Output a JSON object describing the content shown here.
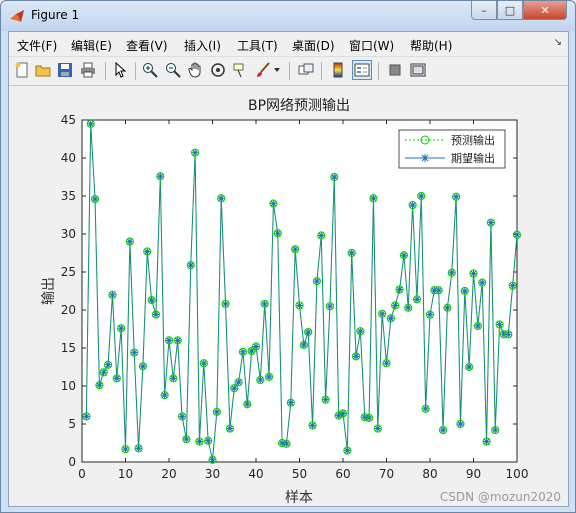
{
  "window": {
    "title": "Figure 1",
    "minimize": "–",
    "maximize": "□",
    "close": "✕"
  },
  "menu": {
    "items": [
      "文件(F)",
      "编辑(E)",
      "查看(V)",
      "插入(I)",
      "工具(T)",
      "桌面(D)",
      "窗口(W)",
      "帮助(H)"
    ],
    "overflow": "↘"
  },
  "toolbar": {
    "icons": [
      "new-figure-icon",
      "open-file-icon",
      "save-icon",
      "print-icon",
      "pointer-icon",
      "zoom-in-icon",
      "zoom-out-icon",
      "pan-hand-icon",
      "rotate-3d-icon",
      "data-cursor-icon",
      "brush-icon",
      "link-plot-icon",
      "colorbar-icon",
      "legend-icon",
      "hide-plot-tools-icon",
      "show-plot-tools-icon"
    ]
  },
  "watermark": "CSDN @mozun2020",
  "chart_data": {
    "type": "line",
    "title": "BP网络预测输出",
    "xlabel": "样本",
    "ylabel": "输出",
    "xlim": [
      0,
      100
    ],
    "ylim": [
      0,
      45
    ],
    "xticks": [
      0,
      10,
      20,
      30,
      40,
      50,
      60,
      70,
      80,
      90,
      100
    ],
    "yticks": [
      0,
      5,
      10,
      15,
      20,
      25,
      30,
      35,
      40,
      45
    ],
    "grid": false,
    "legend_position": "top-right",
    "x": [
      1,
      2,
      3,
      4,
      5,
      6,
      7,
      8,
      9,
      10,
      11,
      12,
      13,
      14,
      15,
      16,
      17,
      18,
      19,
      20,
      21,
      22,
      23,
      24,
      25,
      26,
      27,
      28,
      29,
      30,
      31,
      32,
      33,
      34,
      35,
      36,
      37,
      38,
      39,
      40,
      41,
      42,
      43,
      44,
      45,
      46,
      47,
      48,
      49,
      50,
      51,
      52,
      53,
      54,
      55,
      56,
      57,
      58,
      59,
      60,
      61,
      62,
      63,
      64,
      65,
      66,
      67,
      68,
      69,
      70,
      71,
      72,
      73,
      74,
      75,
      76,
      77,
      78,
      79,
      80,
      81,
      82,
      83,
      84,
      85,
      86,
      87,
      88,
      89,
      90,
      91,
      92,
      93,
      94,
      95,
      96,
      97,
      98,
      99,
      100
    ],
    "series": [
      {
        "name": "预测输出",
        "color": "#00d000",
        "style": "dotted-circle",
        "values": [
          6,
          44.5,
          34.6,
          10.1,
          11.8,
          12.8,
          22,
          11,
          17.6,
          1.7,
          29,
          14.4,
          1.8,
          12.6,
          27.7,
          21.3,
          19.4,
          37.6,
          8.8,
          16,
          11,
          16,
          6,
          3,
          25.9,
          40.7,
          2.7,
          13,
          2.8,
          0.3,
          6.6,
          34.7,
          20.8,
          4.4,
          9.7,
          10.5,
          14.5,
          7.6,
          14.6,
          15.2,
          10.8,
          20.8,
          11.2,
          34,
          30.1,
          2.5,
          2.4,
          7.8,
          28,
          20.6,
          15.4,
          17.1,
          4.8,
          23.8,
          29.8,
          8.2,
          20.5,
          37.5,
          6.1,
          6.4,
          1.5,
          27.5,
          13.9,
          17.2,
          5.9,
          5.8,
          34.7,
          4.4,
          19.5,
          13,
          18.9,
          20.6,
          22.7,
          27.2,
          20.3,
          33.8,
          21.4,
          35,
          7,
          19.4,
          22.6,
          22.6,
          4.2,
          20.3,
          24.9,
          34.9,
          5,
          22.5,
          12.5,
          24.8,
          17.9,
          23.6,
          2.7,
          31.5,
          4.2,
          18.1,
          16.8,
          16.8,
          23.2,
          29.9
        ]
      },
      {
        "name": "期望输出",
        "color": "#1f6fb4",
        "style": "solid-star",
        "values": [
          6,
          44.5,
          34.6,
          10.1,
          11.8,
          12.8,
          22,
          11,
          17.6,
          1.7,
          29,
          14.4,
          1.8,
          12.6,
          27.7,
          21.3,
          19.4,
          37.6,
          8.8,
          16,
          11,
          16,
          6,
          3,
          25.9,
          40.7,
          2.7,
          13,
          2.8,
          0.3,
          6.6,
          34.7,
          20.8,
          4.4,
          9.7,
          10.5,
          14.5,
          7.6,
          14.6,
          15.2,
          10.8,
          20.8,
          11.2,
          34,
          30.1,
          2.5,
          2.4,
          7.8,
          28,
          20.6,
          15.4,
          17.1,
          4.8,
          23.8,
          29.8,
          8.2,
          20.5,
          37.5,
          6.1,
          6.4,
          1.5,
          27.5,
          13.9,
          17.2,
          5.9,
          5.8,
          34.7,
          4.4,
          19.5,
          13,
          18.9,
          20.6,
          22.7,
          27.2,
          20.3,
          33.8,
          21.4,
          35,
          7,
          19.4,
          22.6,
          22.6,
          4.2,
          20.3,
          24.9,
          34.9,
          5,
          22.5,
          12.5,
          24.8,
          17.9,
          23.6,
          2.7,
          31.5,
          4.2,
          18.1,
          16.8,
          16.8,
          23.2,
          29.9
        ]
      }
    ]
  }
}
